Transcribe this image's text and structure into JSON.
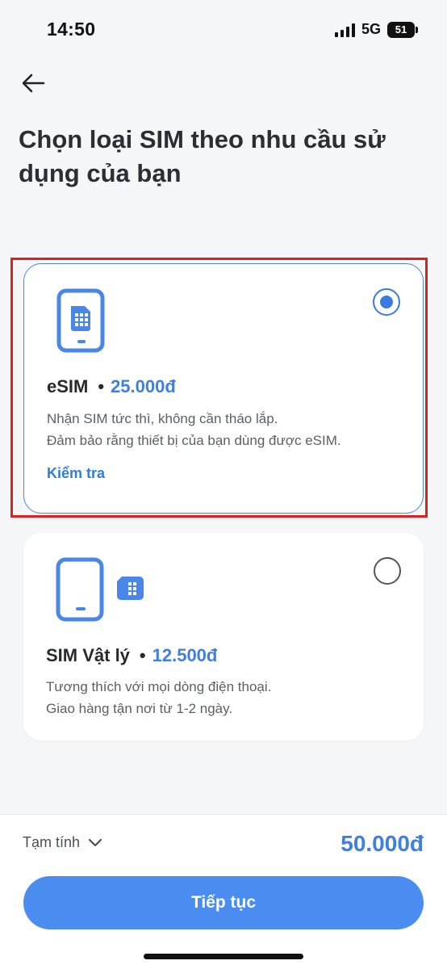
{
  "status_bar": {
    "time": "14:50",
    "network": "5G",
    "battery": "51"
  },
  "header": {
    "title": "Chọn loại SIM theo nhu cầu sử dụng của bạn"
  },
  "options": [
    {
      "name": "eSIM",
      "price": "25.000đ",
      "desc_line1": "Nhận SIM tức thì, không cần tháo lắp.",
      "desc_line2": "Đảm bảo rằng thiết bị của bạn dùng được eSIM.",
      "link": "Kiểm tra",
      "selected": true,
      "icon": "esim-phone-icon"
    },
    {
      "name": "SIM Vật lý",
      "price": "12.500đ",
      "desc_line1": "Tương thích với mọi dòng điện thoại.",
      "desc_line2": "Giao hàng tận nơi từ 1-2 ngày.",
      "selected": false,
      "icon": "physical-sim-icon"
    }
  ],
  "footer": {
    "subtotal_label": "Tạm tính",
    "total": "50.000đ",
    "continue_label": "Tiếp tục"
  },
  "colors": {
    "accent": "#3f7fe0",
    "button": "#4b8cf1",
    "highlight": "#e02020"
  }
}
